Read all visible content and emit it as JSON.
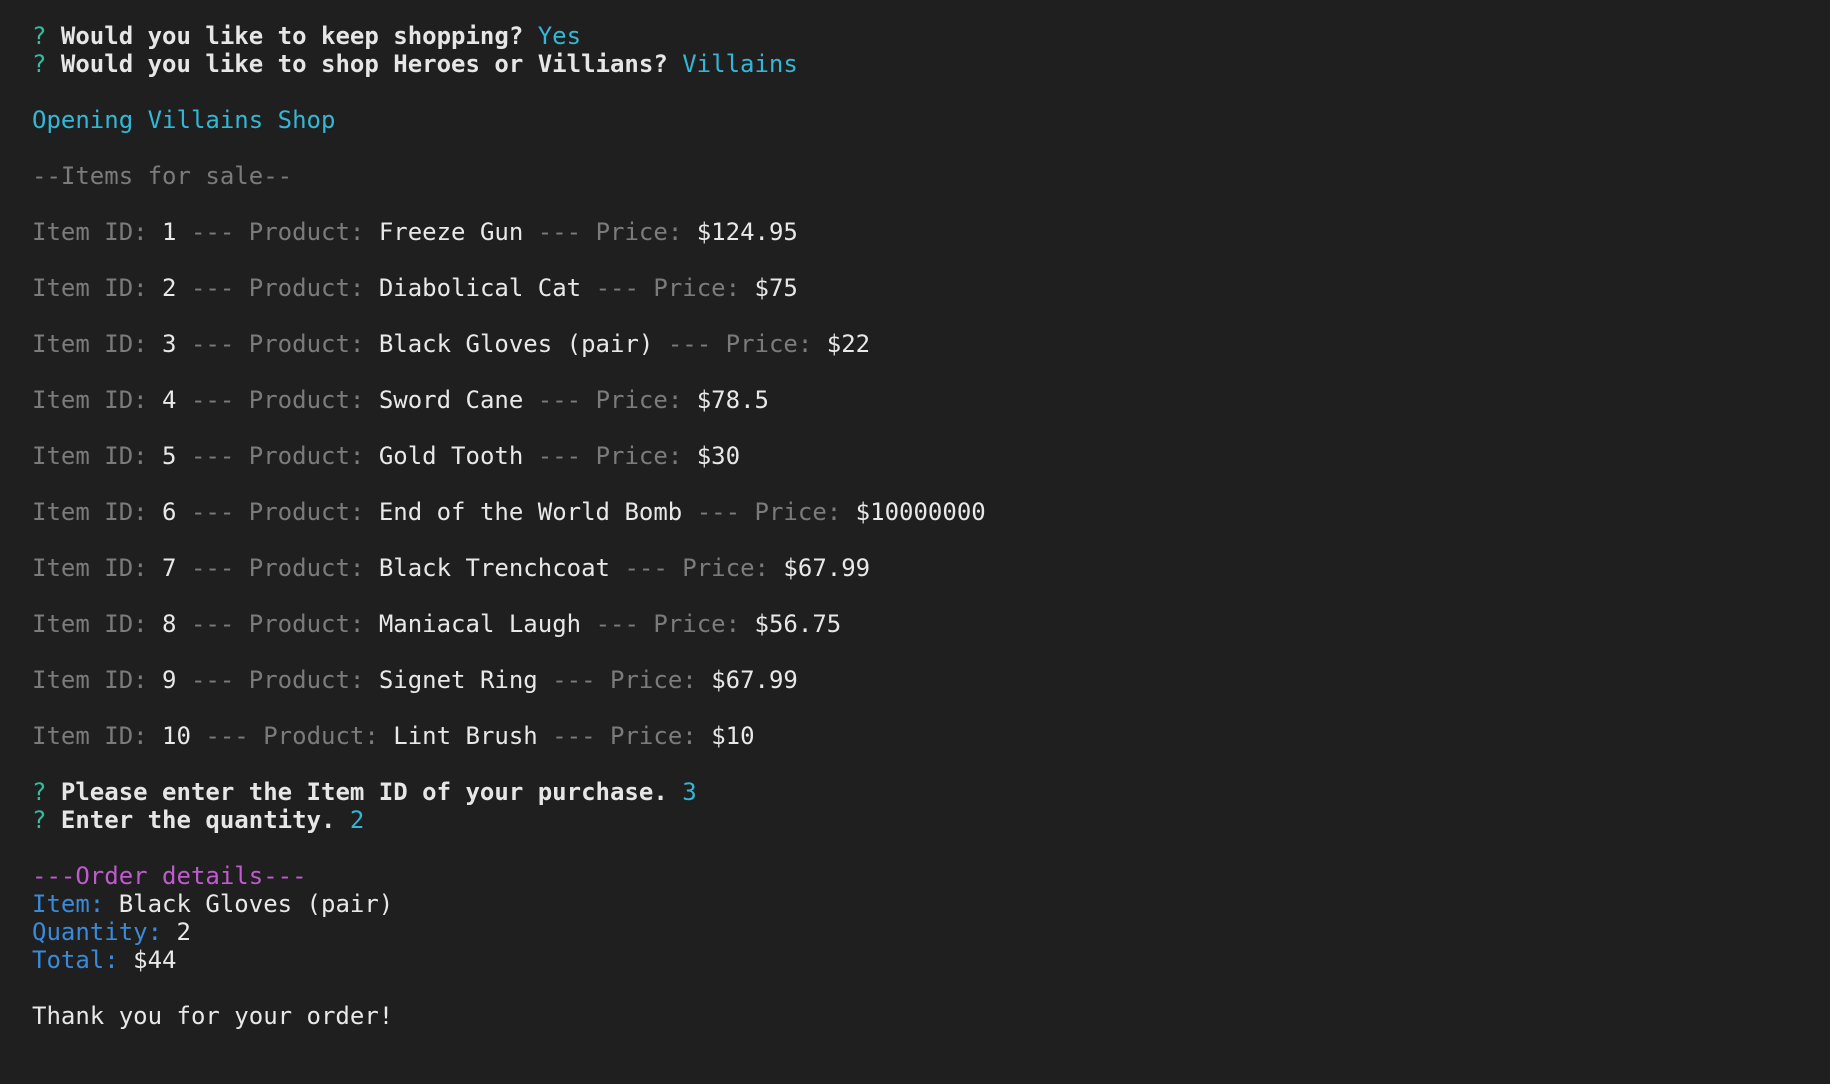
{
  "colors": {
    "background": "#1f1f1f",
    "prompt_mark": "#2fbf9f",
    "answer": "#33b7d6",
    "dim": "#7b7b7b",
    "order_header": "#c15ad0",
    "order_label": "#3a8ad8"
  },
  "prompts_start": [
    {
      "mark": "?",
      "question": "Would you like to keep shopping?",
      "answer": "Yes"
    },
    {
      "mark": "?",
      "question": "Would you like to shop Heroes or Villians?",
      "answer": "Villains"
    }
  ],
  "shop_open": "Opening Villains Shop",
  "items_header": "--Items for sale--",
  "labels": {
    "item_id": "Item ID:",
    "product": "Product:",
    "price": "Price:",
    "sep": "---"
  },
  "items": [
    {
      "id": "1",
      "product": "Freeze Gun",
      "price": "$124.95"
    },
    {
      "id": "2",
      "product": "Diabolical Cat",
      "price": "$75"
    },
    {
      "id": "3",
      "product": "Black Gloves (pair)",
      "price": "$22"
    },
    {
      "id": "4",
      "product": "Sword Cane",
      "price": "$78.5"
    },
    {
      "id": "5",
      "product": "Gold Tooth",
      "price": "$30"
    },
    {
      "id": "6",
      "product": "End of the World Bomb",
      "price": "$10000000"
    },
    {
      "id": "7",
      "product": "Black Trenchcoat",
      "price": "$67.99"
    },
    {
      "id": "8",
      "product": "Maniacal Laugh",
      "price": "$56.75"
    },
    {
      "id": "9",
      "product": "Signet Ring",
      "price": "$67.99"
    },
    {
      "id": "10",
      "product": "Lint Brush",
      "price": "$10"
    }
  ],
  "prompts_purchase": [
    {
      "mark": "?",
      "question": "Please enter the Item ID of your purchase.",
      "answer": "3"
    },
    {
      "mark": "?",
      "question": "Enter the quantity.",
      "answer": "2"
    }
  ],
  "order": {
    "header": "---Order details---",
    "item_label": "Item:",
    "item_value": "Black Gloves (pair)",
    "quantity_label": "Quantity:",
    "quantity_value": "2",
    "total_label": "Total:",
    "total_value": "$44"
  },
  "thank_you": "Thank you for your order!"
}
